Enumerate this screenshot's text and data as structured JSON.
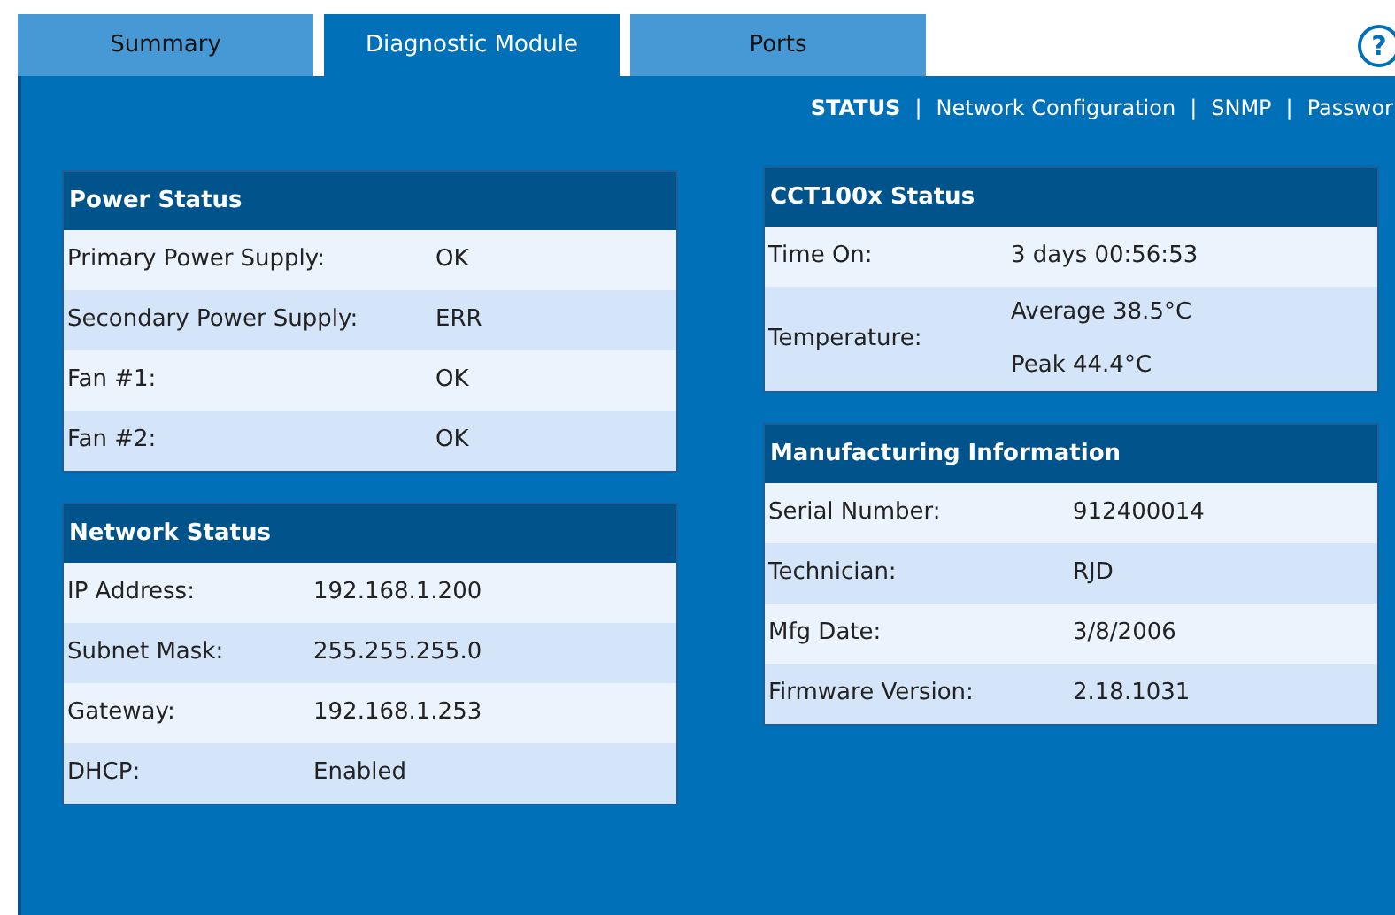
{
  "tabs": [
    {
      "label": "Summary",
      "selected": false
    },
    {
      "label": "Diagnostic Module",
      "selected": true
    },
    {
      "label": "Ports",
      "selected": false
    }
  ],
  "help": {
    "label": "?"
  },
  "subnav": [
    {
      "label": "STATUS",
      "selected": true
    },
    {
      "label": "Network Configuration",
      "selected": false
    },
    {
      "label": "SNMP",
      "selected": false
    },
    {
      "label": "Passwor",
      "selected": false
    }
  ],
  "subnav_separator": "|",
  "columns": [
    [
      {
        "title": "Power Status",
        "rows": [
          {
            "label": "Primary Power Supply:",
            "values": [
              "OK"
            ]
          },
          {
            "label": "Secondary Power Supply:",
            "values": [
              "ERR"
            ]
          },
          {
            "label": "Fan #1:",
            "values": [
              "OK"
            ]
          },
          {
            "label": "Fan #2:",
            "values": [
              "OK"
            ]
          }
        ]
      },
      {
        "title": "Network Status",
        "rows": [
          {
            "label": "IP Address:",
            "values": [
              "192.168.1.200"
            ]
          },
          {
            "label": "Subnet Mask:",
            "values": [
              "255.255.255.0"
            ]
          },
          {
            "label": "Gateway:",
            "values": [
              "192.168.1.253"
            ]
          },
          {
            "label": "DHCP:",
            "values": [
              "Enabled"
            ]
          }
        ]
      }
    ],
    [
      {
        "title": "CCT100x Status",
        "rows": [
          {
            "label": "Time On:",
            "values": [
              "3 days 00:56:53"
            ]
          },
          {
            "label": "Temperature:",
            "values": [
              "Average 38.5°C",
              "Peak 44.4°C"
            ]
          }
        ]
      },
      {
        "title": "Manufacturing Information",
        "rows": [
          {
            "label": "Serial Number:",
            "values": [
              "912400014"
            ]
          },
          {
            "label": "Technician:",
            "values": [
              "RJD"
            ]
          },
          {
            "label": "Mfg Date:",
            "values": [
              "3/8/2006"
            ]
          },
          {
            "label": "Firmware Version:",
            "values": [
              "2.18.1031"
            ]
          }
        ]
      }
    ]
  ]
}
